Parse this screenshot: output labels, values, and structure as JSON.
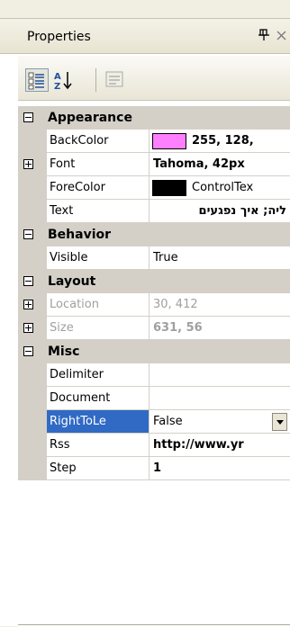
{
  "window": {
    "title": "Properties"
  },
  "toolbar": {
    "categorized_icon": "categorized-icon",
    "alphabetical_icon": "alphabetical-icon",
    "property_pages_icon": "property-pages-icon"
  },
  "categories": {
    "appearance": "Appearance",
    "behavior": "Behavior",
    "layout": "Layout",
    "misc": "Misc"
  },
  "properties": {
    "backcolor": {
      "name": "BackColor",
      "value": "255, 128,",
      "swatch": "#ff80ff"
    },
    "font": {
      "name": "Font",
      "value": "Tahoma, 42px"
    },
    "forecolor": {
      "name": "ForeColor",
      "value": "ControlTex",
      "swatch": "#000000"
    },
    "text": {
      "name": "Text",
      "value": "ליה; איך נפגעים"
    },
    "visible": {
      "name": "Visible",
      "value": "True"
    },
    "location": {
      "name": "Location",
      "value": "30, 412"
    },
    "size": {
      "name": "Size",
      "value": "631, 56"
    },
    "delimiter": {
      "name": "Delimiter",
      "value": ""
    },
    "document": {
      "name": "Document",
      "value": ""
    },
    "righttoleft": {
      "name": "RightToLe",
      "value": "False"
    },
    "rss": {
      "name": "Rss",
      "value": "http://www.yr"
    },
    "step": {
      "name": "Step",
      "value": "1"
    }
  },
  "colors": {
    "selection": "#316ac5",
    "gutter": "#d4d0c8"
  }
}
